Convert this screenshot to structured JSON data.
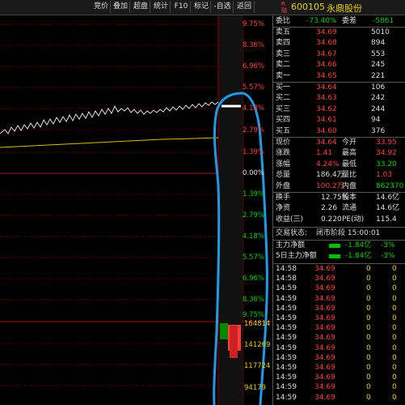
{
  "toolbar": {
    "buttons": [
      "竞价",
      "叠加",
      "超盘",
      "统计",
      "F10",
      "标记",
      "-自选",
      "返回"
    ]
  },
  "chart_data": {
    "type": "line",
    "price_axis_labels": [
      "9.75%",
      "8.36%",
      "6.96%",
      "5.57%",
      "4.18%",
      "2.79%",
      "1.39%",
      "0.00%",
      "1.39%",
      "2.79%",
      "4.18%",
      "5.57%",
      "6.96%",
      "8.36%",
      "9.75%"
    ],
    "volume_axis_labels": [
      "164814",
      "141269",
      "117724",
      "94179"
    ]
  },
  "stock": {
    "code": "600105",
    "name": "永鼎股份",
    "market_flag": "R",
    "market_flag2": "融"
  },
  "header_row": {
    "webi_label": "委比",
    "webi_value": "-73.40%",
    "weicha_label": "委差",
    "weicha_value": "-5861"
  },
  "sell_orders": [
    {
      "label": "卖五",
      "price": "34.69",
      "volume": "5010"
    },
    {
      "label": "卖四",
      "price": "34.68",
      "volume": "894"
    },
    {
      "label": "卖三",
      "price": "34.67",
      "volume": "553"
    },
    {
      "label": "卖二",
      "price": "34.66",
      "volume": "245"
    },
    {
      "label": "卖一",
      "price": "34.65",
      "volume": "221"
    }
  ],
  "buy_orders": [
    {
      "label": "买一",
      "price": "34.64",
      "volume": "106"
    },
    {
      "label": "买二",
      "price": "34.63",
      "volume": "242"
    },
    {
      "label": "买三",
      "price": "34.62",
      "volume": "244"
    },
    {
      "label": "买四",
      "price": "34.61",
      "volume": "94"
    },
    {
      "label": "买五",
      "price": "34.60",
      "volume": "376"
    }
  ],
  "quote": [
    {
      "l1": "现价",
      "v1": "34.64",
      "l2": "今开",
      "v2": "33.95"
    },
    {
      "l1": "涨跌",
      "v1": "1.41",
      "l2": "最高",
      "v2": "34.92"
    },
    {
      "l1": "涨幅",
      "v1": "4.24%",
      "l2": "最低",
      "v2": "33.20"
    },
    {
      "l1": "总量",
      "v1": "186.4万",
      "l2": "量比",
      "v2": "1.03"
    },
    {
      "l1": "外盘",
      "v1": "100.2万",
      "l2": "内盘",
      "v2": "862370"
    }
  ],
  "stats": [
    {
      "l1": "换手",
      "v1": "12.75%",
      "l2": "股本",
      "v2": "14.6亿"
    },
    {
      "l1": "净资",
      "v1": "2.26",
      "l2": "流通",
      "v2": "14.6亿"
    },
    {
      "l1": "收益(三)",
      "v1": "0.220",
      "l2": "PE(动)",
      "v2": "115.4"
    }
  ],
  "status": {
    "label": "交易状态:",
    "value": "闭市阶段 15:00:01"
  },
  "flows": [
    {
      "label": "主力净额",
      "value": "-1.84亿",
      "pct": "-3%"
    },
    {
      "label": "5日主力净额",
      "value": "-1.84亿",
      "pct": "-3%"
    }
  ],
  "trades": [
    {
      "time": "14:58",
      "price": "34.69",
      "vol": "0"
    },
    {
      "time": "14:58",
      "price": "34.69",
      "vol": "0"
    },
    {
      "time": "14:59",
      "price": "34.69",
      "vol": "0"
    },
    {
      "time": "14:59",
      "price": "34.69",
      "vol": "0"
    },
    {
      "time": "14:59",
      "price": "34.69",
      "vol": "0"
    },
    {
      "time": "14:59",
      "price": "34.69",
      "vol": "0"
    },
    {
      "time": "14:59",
      "price": "34.69",
      "vol": "0"
    },
    {
      "time": "14:59",
      "price": "34.69",
      "vol": "0"
    },
    {
      "time": "14:59",
      "price": "34.69",
      "vol": "0"
    },
    {
      "time": "14:59",
      "price": "34.69",
      "vol": "0"
    },
    {
      "time": "14:59",
      "price": "34.69",
      "vol": "0"
    },
    {
      "time": "14:59",
      "price": "34.69",
      "vol": "0"
    },
    {
      "time": "14:59",
      "price": "34.69",
      "vol": "0"
    },
    {
      "time": "14:59",
      "price": "34.69",
      "vol": "0"
    }
  ],
  "colors": {
    "up": "#ff3c3c",
    "down": "#00d000",
    "annotation": "#1e9be8"
  }
}
